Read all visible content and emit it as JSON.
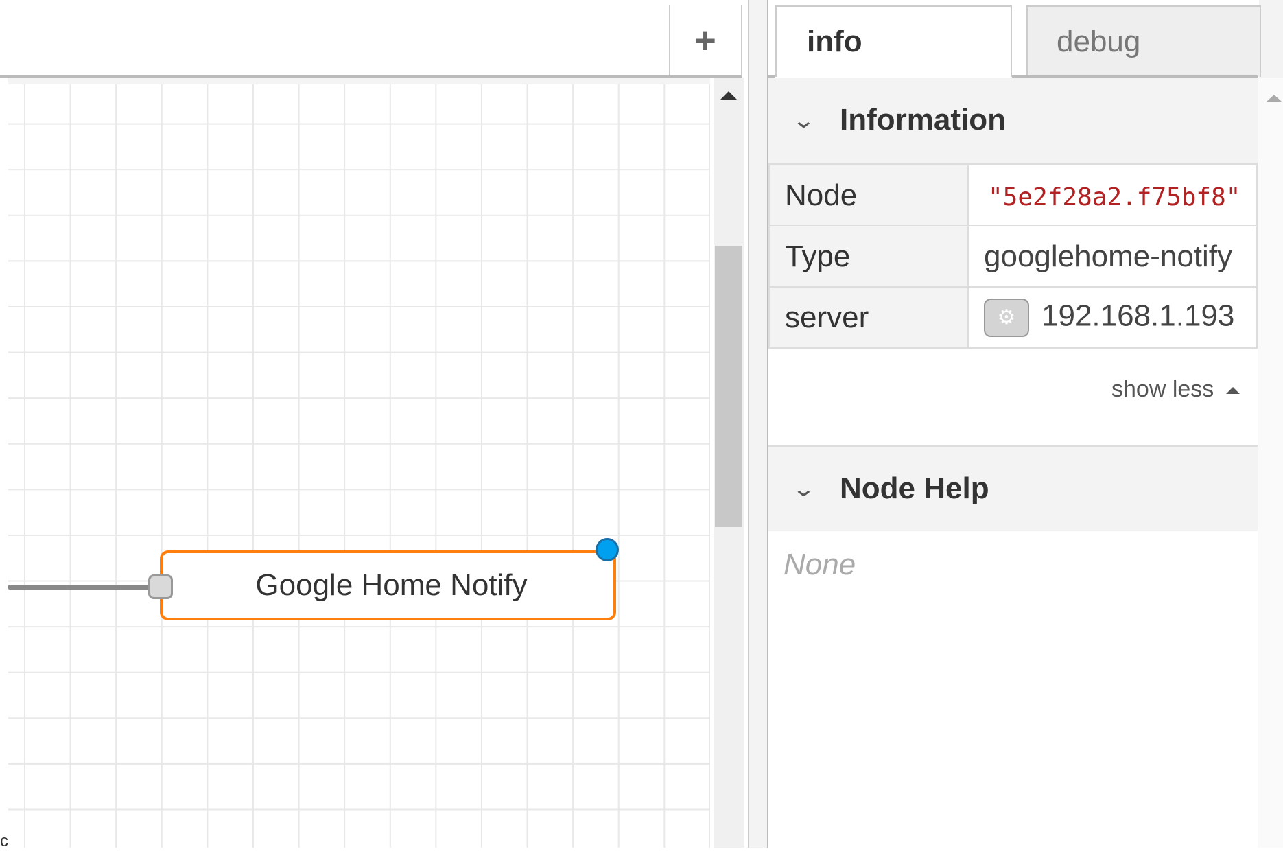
{
  "workspace": {
    "add_tab_label": "+",
    "node_label": "Google Home Notify",
    "stray_text": "c"
  },
  "sidebar": {
    "tabs": [
      {
        "label": "info",
        "active": true
      },
      {
        "label": "debug",
        "active": false
      }
    ],
    "information": {
      "title": "Information",
      "rows": [
        {
          "key": "Node",
          "value": "\"5e2f28a2.f75bf8\""
        },
        {
          "key": "Type",
          "value": "googlehome-notify"
        },
        {
          "key": "server",
          "value": "192.168.1.193"
        }
      ],
      "show_less": "show less"
    },
    "node_help": {
      "title": "Node Help",
      "content": "None"
    }
  },
  "colors": {
    "node_border": "#ff7f0e",
    "changed_dot": "#00a0f0",
    "node_id_text": "#b22222"
  },
  "icons": {
    "add": "plus-icon",
    "expand": "chevron-down-icon",
    "config": "gear-icon",
    "collapse": "triangle-up-icon"
  }
}
